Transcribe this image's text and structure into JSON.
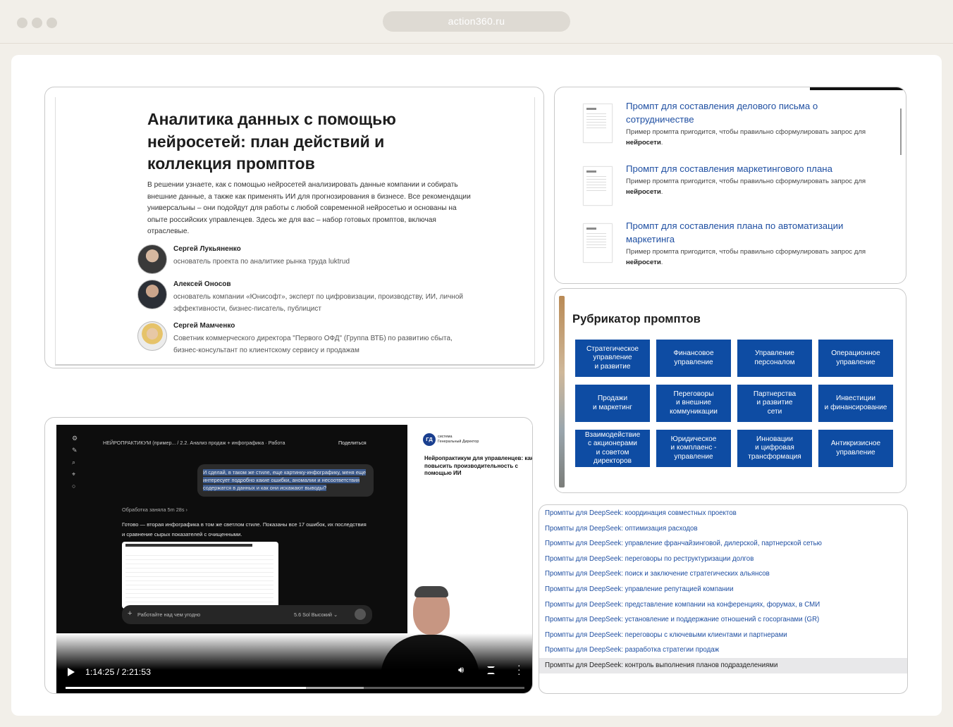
{
  "browser": {
    "url": "action360.ru"
  },
  "article": {
    "title": "Аналитика данных с помощью нейросетей: план действий и коллекция промптов",
    "description": "В решении узнаете, как с помощью нейросетей анализировать данные компании  и собирать внешние данные, а также как применять ИИ для прогнозирования в бизнесе. Все рекомендации универсальны – они подойдут для работы с любой современной нейросетью и основаны на опыте российских управленцев. Здесь же для вас – набор готовых промптов, включая отраслевые.",
    "authors": [
      {
        "name": "Сергей Лукьяненко",
        "role": "основатель проекта по аналитике рынка труда luktrud"
      },
      {
        "name": "Алексей Оносов",
        "role": "основатель компании «Юнисофт», эксперт по цифровизации, производству, ИИ, личной эффективности, бизнес-писатель, публицист"
      },
      {
        "name": "Сергей Мамченко",
        "role": "Советник коммерческого директора \"Первого ОФД\" (Группа ВТБ) по развитию сбыта, бизнес-консультант по клиентскому сервису и продажам"
      }
    ]
  },
  "prompts": {
    "desc_prefix": "Пример промпта пригодится, чтобы правильно сформулировать запрос для ",
    "desc_bold": "нейросети",
    "desc_suffix": ".",
    "items": [
      {
        "title": "Промпт для составления делового письма о сотрудничестве"
      },
      {
        "title": "Промпт для составления маркетингового плана"
      },
      {
        "title": "Промпт для составления плана по автоматизации маркетинга"
      }
    ]
  },
  "rubricator": {
    "title": "Рубрикатор промптов",
    "buttons": [
      "Стратегическое\nуправление\nи развитие",
      "Финансовое\nуправление",
      "Управление\nперсоналом",
      "Операционное\nуправление",
      "Продажи\nи маркетинг",
      "Переговоры\nи внешние\nкоммуникации",
      "Партнерства\nи развитие\nсети",
      "Инвестиции\nи финансирование",
      "Взаимодействие\nс акционерами\nи советом\nдиректоров",
      "Юридическое\nи комплаенс -\nуправление",
      "Инновации\nи цифровая\nтрансформация",
      "Антикризисное\nуправление"
    ]
  },
  "video": {
    "crumbs": "НЕЙРОПРАКТИКУМ (пример...  /  2.2. Анализ продаж + инфографика  ·  Работа",
    "share": "Поделиться",
    "user_message_hl": "И сделай, в таком же стиле, еще картинку-инфографику, меня еще интересует подробно какие ошибки, аномалии и несоответствия содержатся в данных и как они искажают выводы?",
    "elapsed": "Обработка заняла 5m 28s  ›",
    "answer": "Готово — вторая инфографика в том же светлом стиле. Показаны все 17 ошибок, их последствия и сравнение сырых показателей с очищенными.",
    "composer_placeholder": "Работайте над чем угодно",
    "composer_model": "5.6 Sol Высокий  ⌄",
    "slide_logo": "ГД",
    "slide_brand_1": "система",
    "slide_brand_2": "Генеральный Директор",
    "slide_title": "Нейропрактикум для управленцев: как повысить производительность с помощью ИИ",
    "time": "1:14:25 / 2:21:53",
    "progress": 0.524
  },
  "deepseek_links": [
    "Промпты для DeepSeek: координация совместных проектов",
    "Промпты для DeepSeek: оптимизация расходов",
    "Промпты для DeepSeek: управление франчайзинговой, дилерской, партнерской сетью",
    "Промпты для DeepSeek: переговоры по реструктуризации долгов",
    "Промпты для DeepSeek: поиск и заключение стратегических альянсов",
    "Промпты для DeepSeek: управление репутацией компании",
    "Промпты для DeepSeek: представление компании на конференциях, форумах, в СМИ",
    "Промпты для DeepSeek: установление и поддержание отношений с госорганами (GR)",
    "Промпты для DeepSeek: переговоры с ключевыми клиентами и партнерами",
    "Промпты для DeepSeek: разработка стратегии продаж",
    "Промпты для DeepSeek: контроль выполнения планов подразделениями"
  ]
}
